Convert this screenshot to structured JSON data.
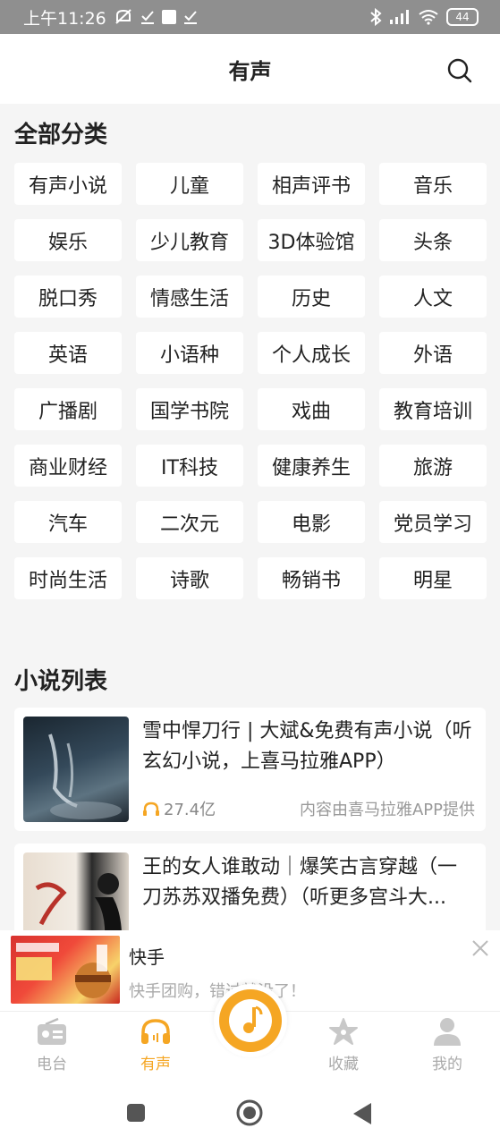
{
  "status": {
    "time": "上午11:26",
    "battery": "44"
  },
  "header": {
    "title": "有声"
  },
  "categories": {
    "title": "全部分类",
    "items": [
      "有声小说",
      "儿童",
      "相声评书",
      "音乐",
      "娱乐",
      "少儿教育",
      "3D体验馆",
      "头条",
      "脱口秀",
      "情感生活",
      "历史",
      "人文",
      "英语",
      "小语种",
      "个人成长",
      "外语",
      "广播剧",
      "国学书院",
      "戏曲",
      "教育培训",
      "商业财经",
      "IT科技",
      "健康养生",
      "旅游",
      "汽车",
      "二次元",
      "电影",
      "党员学习",
      "时尚生活",
      "诗歌",
      "畅销书",
      "明星"
    ]
  },
  "novels": {
    "title": "小说列表",
    "items": [
      {
        "title": "雪中悍刀行 | 大斌&免费有声小说（听玄幻小说，上喜马拉雅APP）",
        "plays": "27.4亿",
        "source": "内容由喜马拉雅APP提供"
      },
      {
        "title": "王的女人谁敢动｜爆笑古言穿越（一刀苏苏双播免费）（听更多宫斗大..."
      }
    ]
  },
  "ad": {
    "title": "快手",
    "subtitle": "快手团购，错过就没了！"
  },
  "tabs": [
    {
      "label": "电台",
      "icon": "radio-icon",
      "active": false
    },
    {
      "label": "有声",
      "icon": "headphones-icon",
      "active": true
    },
    {
      "label": "收藏",
      "icon": "star-icon",
      "active": false
    },
    {
      "label": "我的",
      "icon": "person-icon",
      "active": false
    }
  ],
  "colors": {
    "accent": "#f5a623",
    "inactive": "#aaaaaa",
    "background": "#f5f5f5"
  }
}
